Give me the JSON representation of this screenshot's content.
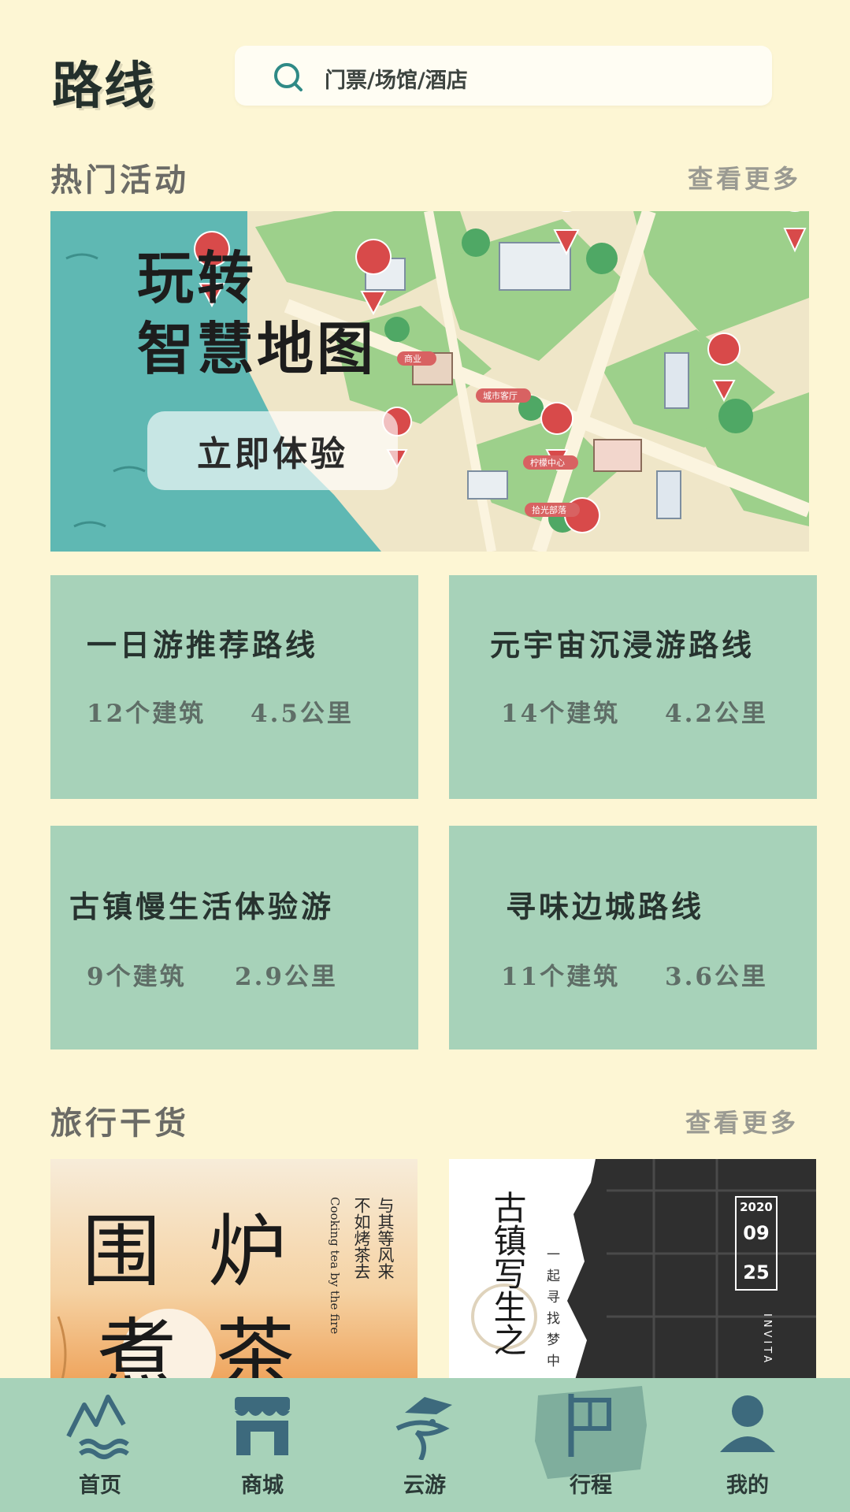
{
  "header": {
    "title": "路线",
    "search_placeholder": "门票/场馆/酒店"
  },
  "hot_activities": {
    "title": "热门活动",
    "more_label": "查看更多",
    "banner": {
      "title_line1": "玩转",
      "title_line2": "智慧地图",
      "button_label": "立即体验",
      "map_labels": [
        "城市客厅",
        "柠檬中心",
        "拾光部落",
        "商业"
      ]
    },
    "routes": [
      {
        "name": "一日游推荐路线",
        "buildings": "12个建筑",
        "distance": "4.5公里"
      },
      {
        "name": "元宇宙沉浸游路线",
        "buildings": "14个建筑",
        "distance": "4.2公里"
      },
      {
        "name": "古镇慢生活体验游",
        "buildings": "9个建筑",
        "distance": "2.9公里"
      },
      {
        "name": "寻味边城路线",
        "buildings": "11个建筑",
        "distance": "3.6公里"
      }
    ]
  },
  "travel_tips": {
    "title": "旅行干货",
    "more_label": "查看更多",
    "articles": [
      {
        "big_text": [
          "围",
          "炉",
          "煮",
          "茶"
        ],
        "side_text_1": "与其等风来",
        "side_text_2": "不如烤茶去",
        "english": "Cooking tea by the fire"
      },
      {
        "big_text": "古镇写生之",
        "side_text": "一起寻找梦中",
        "year": "2020",
        "month": "09",
        "day": "25",
        "english": "INVITA"
      }
    ]
  },
  "tabbar": {
    "items": [
      {
        "label": "首页",
        "icon": "home-mountain-icon"
      },
      {
        "label": "商城",
        "icon": "shop-icon"
      },
      {
        "label": "云游",
        "icon": "cloud-travel-icon"
      },
      {
        "label": "行程",
        "icon": "flag-icon",
        "active": true
      },
      {
        "label": "我的",
        "icon": "user-icon"
      }
    ]
  },
  "colors": {
    "background": "#fdf6d4",
    "card": "#a7d2b9",
    "icon": "#3d6a7d",
    "water": "#5fb8b3"
  }
}
